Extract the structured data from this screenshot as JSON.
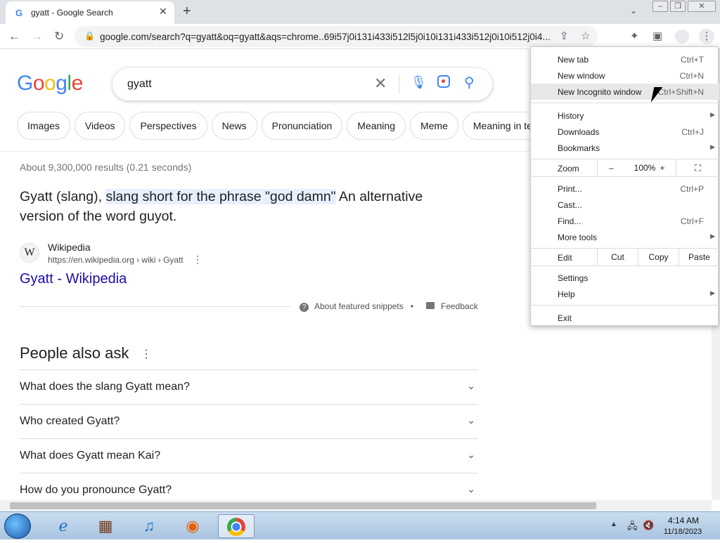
{
  "browser": {
    "tab": {
      "title": "gyatt - Google Search",
      "favicon": "G"
    },
    "new_tab_icon": "+",
    "url": "google.com/search?q=gyatt&oq=gyatt&aqs=chrome..69i57j0i131i433i512l5j0i10i131i433i512j0i10i512j0i4..."
  },
  "search": {
    "logo_letters": [
      "G",
      "o",
      "o",
      "g",
      "l",
      "e"
    ],
    "logo_colors": [
      "#4285f4",
      "#ea4335",
      "#fbbc05",
      "#4285f4",
      "#34a853",
      "#ea4335"
    ],
    "query": "gyatt"
  },
  "chips": [
    "Images",
    "Videos",
    "Perspectives",
    "News",
    "Pronunciation",
    "Meaning",
    "Meme",
    "Meaning in te"
  ],
  "results": {
    "stats": "About 9,300,000 results (0.21 seconds)",
    "snippet_pre": "Gyatt (slang), ",
    "snippet_hl": "slang short for the phrase \"god damn\"",
    "snippet_post": " An alternative version of the word guyot.",
    "source_name": "Wikipedia",
    "source_favicon": "W",
    "source_url": "https://en.wikipedia.org › wiki › Gyatt",
    "link": "Gyatt - Wikipedia",
    "about_snippets": "About featured snippets",
    "bullet": "•",
    "feedback": "Feedback"
  },
  "paa": {
    "title": "People also ask",
    "questions": [
      "What does the slang Gyatt mean?",
      "Who created Gyatt?",
      "What does Gyatt mean Kai?",
      "How do you pronounce Gyatt?"
    ]
  },
  "menu": {
    "new_tab": "New tab",
    "new_tab_sc": "Ctrl+T",
    "new_window": "New window",
    "new_window_sc": "Ctrl+N",
    "incognito": "New Incognito window",
    "incognito_sc": "Ctrl+Shift+N",
    "history": "History",
    "downloads": "Downloads",
    "downloads_sc": "Ctrl+J",
    "bookmarks": "Bookmarks",
    "zoom": "Zoom",
    "zoom_minus": "–",
    "zoom_value": "100%",
    "zoom_plus": "+",
    "print": "Print...",
    "print_sc": "Ctrl+P",
    "cast": "Cast...",
    "find": "Find...",
    "find_sc": "Ctrl+F",
    "more_tools": "More tools",
    "edit": "Edit",
    "cut": "Cut",
    "copy": "Copy",
    "paste": "Paste",
    "settings": "Settings",
    "help": "Help",
    "exit": "Exit"
  },
  "taskbar": {
    "time": "4:14 AM",
    "date": "11/18/2023"
  }
}
